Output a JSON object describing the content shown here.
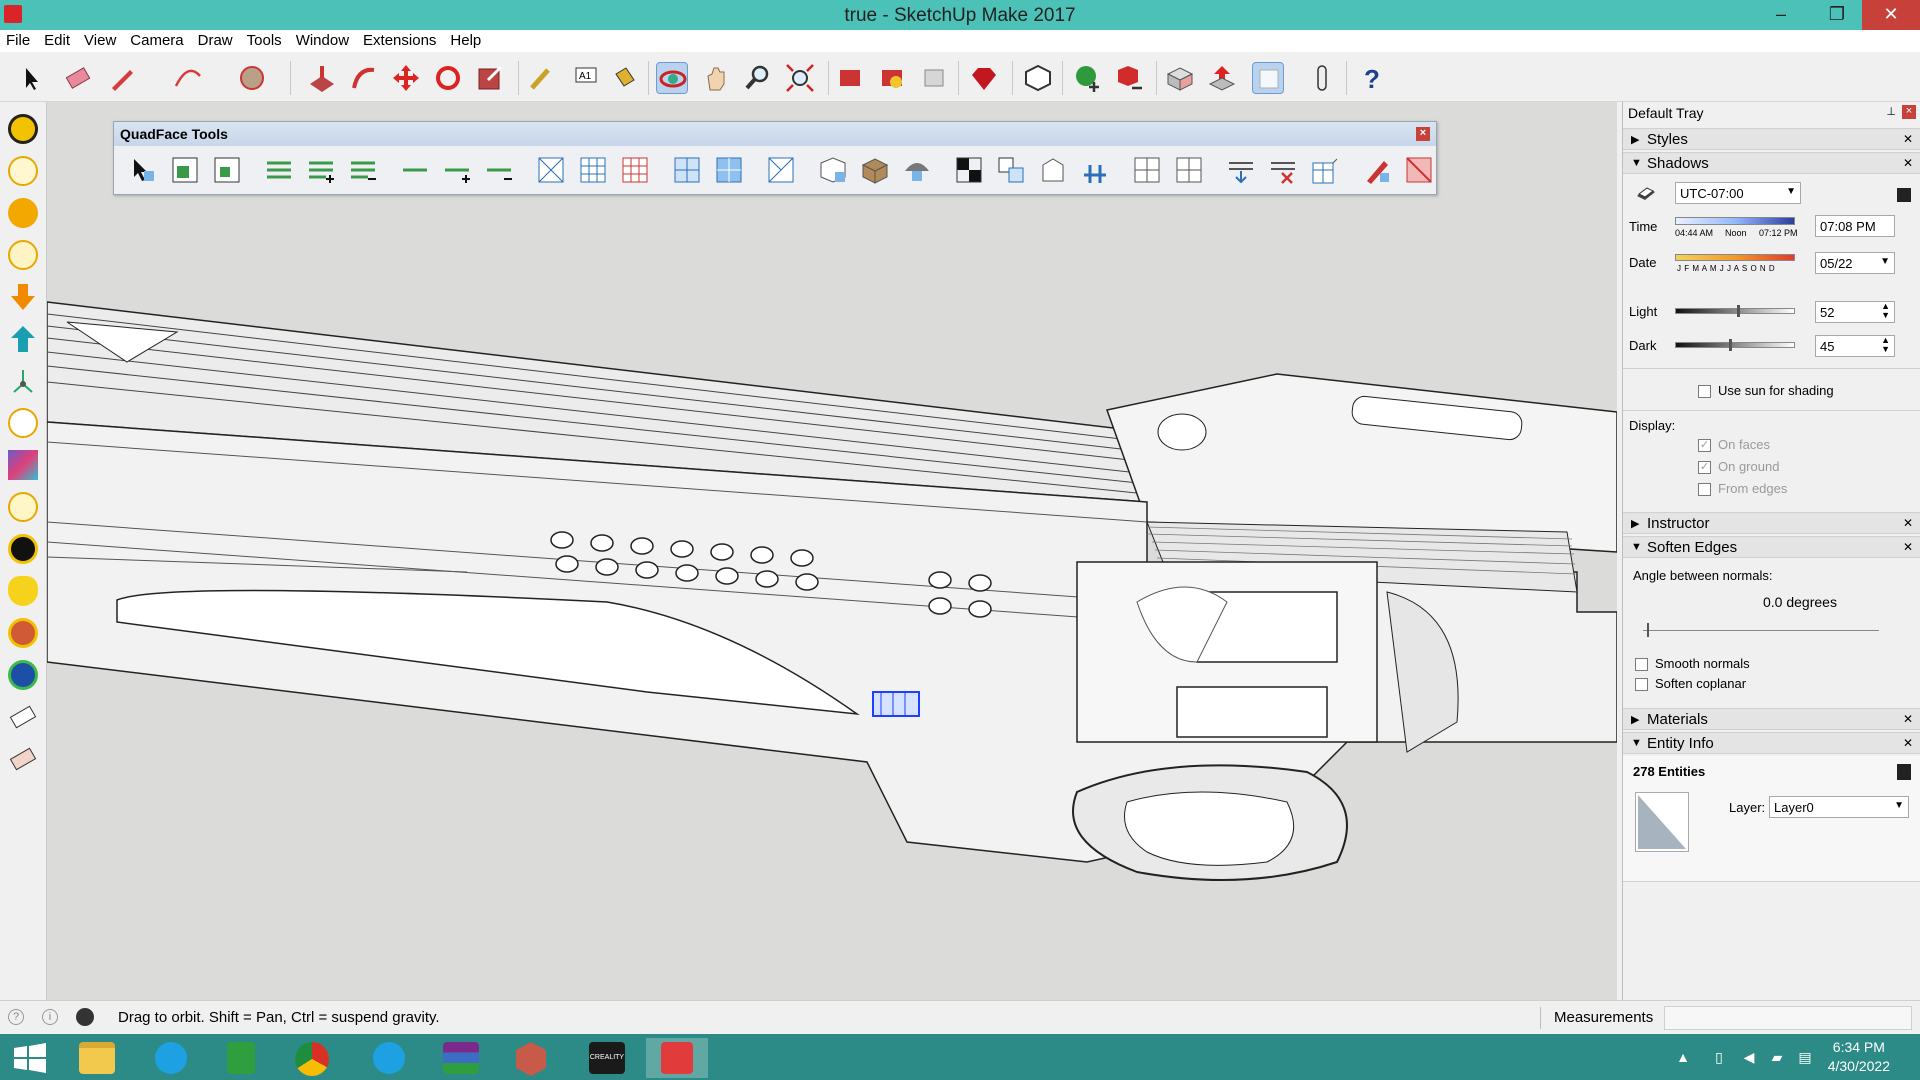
{
  "window": {
    "title": "true - SketchUp Make 2017",
    "minimize_glyph": "–",
    "restore_glyph": "❐",
    "close_glyph": "✕"
  },
  "menu": [
    "File",
    "Edit",
    "View",
    "Camera",
    "Draw",
    "Tools",
    "Window",
    "Extensions",
    "Help"
  ],
  "quadface": {
    "title": "QuadFace Tools",
    "close_glyph": "×"
  },
  "tray": {
    "title": "Default Tray",
    "pin_glyph": "⊥",
    "close_glyph": "×",
    "sections": {
      "styles": "Styles",
      "shadows": "Shadows",
      "instructor": "Instructor",
      "soften_edges": "Soften Edges",
      "materials": "Materials",
      "entity_info": "Entity Info"
    },
    "shadows": {
      "timezone": "UTC-07:00",
      "time_label": "Time",
      "time_scale": [
        "04:44 AM",
        "Noon",
        "07:12 PM"
      ],
      "time_value": "07:08 PM",
      "date_label": "Date",
      "date_scale": "J F M A M J J A S O N D",
      "date_value": "05/22",
      "light_label": "Light",
      "light_value": "52",
      "light_level": 0.52,
      "dark_label": "Dark",
      "dark_value": "45",
      "dark_level": 0.45,
      "use_sun": "Use sun for shading",
      "display_label": "Display:",
      "on_faces": "On faces",
      "on_faces_checked": true,
      "on_ground": "On ground",
      "on_ground_checked": true,
      "from_edges": "From edges",
      "from_edges_checked": false
    },
    "soften": {
      "angle_label": "Angle between normals:",
      "angle_value": "0.0  degrees",
      "smooth_normals": "Smooth normals",
      "soften_coplanar": "Soften coplanar"
    },
    "entity": {
      "count": "278 Entities",
      "layer_label": "Layer:",
      "layer_value": "Layer0"
    }
  },
  "status": {
    "message": "Drag to orbit. Shift = Pan, Ctrl = suspend gravity.",
    "measurements_label": "Measurements",
    "measurements_value": ""
  },
  "taskbar": {
    "time": "6:34 PM",
    "date": "4/30/2022",
    "app_label": "CREALITY"
  },
  "icons": {
    "toolbar": [
      "select-icon",
      "eraser-icon",
      "pencil-icon",
      "arc-icon",
      "circle-icon",
      "push-pull-icon",
      "follow-me-icon",
      "move-icon",
      "rotate-icon",
      "scale-icon",
      "tape-measure-icon",
      "text-icon",
      "paint-bucket-icon",
      "orbit-icon",
      "pan-icon",
      "zoom-icon",
      "zoom-extents-icon",
      "warehouse-icon",
      "extension-warehouse-icon",
      "layout-icon",
      "ruby-icon",
      "component-icon",
      "add-location-icon",
      "remove-location-icon",
      "photo-texture-icon",
      "share-model-icon",
      "xray-icon",
      "walk-icon",
      "help-icon"
    ],
    "left": [
      "sun-icon",
      "bulb-icon",
      "orange-hex-icon",
      "hex-icon",
      "down-arrow-icon",
      "up-arrow-icon",
      "axes-icon",
      "outline-icon",
      "section-icon",
      "section-plane-icon",
      "black-hex-icon",
      "shield-icon",
      "face-icon",
      "sphere-icon",
      "eraser-small-icon",
      "eraser-alt-icon"
    ]
  }
}
